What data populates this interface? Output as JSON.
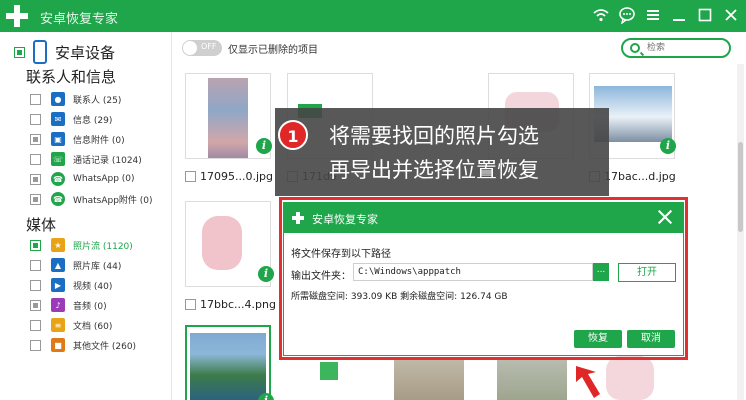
{
  "window": {
    "title": "安卓恢复专家"
  },
  "sidebar": {
    "device_title": "安卓设备",
    "sections": [
      {
        "title": "联系人和信息",
        "items": [
          {
            "label": "联系人 (25)",
            "icon": "contacts-icon",
            "color": "#1a6fc4"
          },
          {
            "label": "信息 (29)",
            "icon": "message-icon",
            "color": "#1a6fc4"
          },
          {
            "label": "信息附件 (0)",
            "icon": "attachment-icon",
            "color": "#1a6fc4"
          },
          {
            "label": "通话记录 (1024)",
            "icon": "call-log-icon",
            "color": "#1fa54a"
          },
          {
            "label": "WhatsApp (0)",
            "icon": "whatsapp-icon",
            "color": "#1fa54a"
          },
          {
            "label": "WhatsApp附件 (0)",
            "icon": "whatsapp-attachment-icon",
            "color": "#1fa54a"
          }
        ]
      },
      {
        "title": "媒体",
        "items": [
          {
            "label": "照片流 (1120)",
            "icon": "photo-stream-icon",
            "color": "#e8a317"
          },
          {
            "label": "照片库 (44)",
            "icon": "photo-library-icon",
            "color": "#1a6fc4"
          },
          {
            "label": "视频 (40)",
            "icon": "video-icon",
            "color": "#1a6fc4"
          },
          {
            "label": "音频 (0)",
            "icon": "audio-icon",
            "color": "#9b3bb8"
          },
          {
            "label": "文档 (60)",
            "icon": "document-icon",
            "color": "#e8a317"
          },
          {
            "label": "其他文件 (260)",
            "icon": "other-files-icon",
            "color": "#e07a17"
          }
        ]
      }
    ]
  },
  "toolbar": {
    "toggle_text": "OFF",
    "toggle_label": "仅显示已删除的项目",
    "search_placeholder": "检索"
  },
  "gallery": {
    "files": [
      "17095...0.jpg",
      "171d5",
      "17bac...d.jpg",
      "17bbc...4.png"
    ]
  },
  "callout": {
    "step": "1",
    "line1": "将需要找回的照片勾选",
    "line2": "再导出并选择位置恢复"
  },
  "dialog": {
    "title": "安卓恢复专家",
    "prompt": "将文件保存到以下路径",
    "folder_label": "输出文件夹：",
    "path": "C:\\Windows\\apppatch",
    "browse_label": "...",
    "open_label": "打开",
    "space_text": "所需磁盘空间:  393.09 KB  剩余磁盘空间:   126.74 GB",
    "restore_label": "恢复",
    "cancel_label": "取消"
  },
  "colors": {
    "accent": "#1fa54a",
    "highlight": "#e03030"
  }
}
